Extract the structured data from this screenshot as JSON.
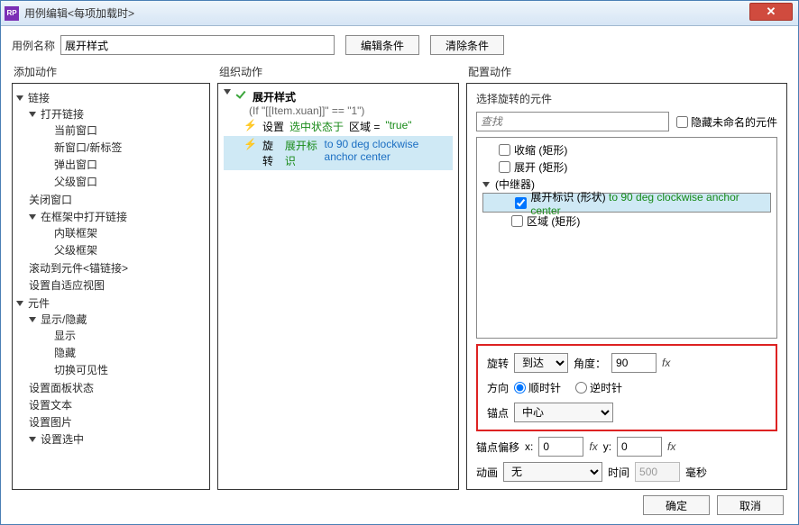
{
  "window": {
    "title": "用例编辑<每项加载时>"
  },
  "header": {
    "name_label": "用例名称",
    "name_value": "展开样式",
    "edit_condition": "编辑条件",
    "clear_condition": "清除条件"
  },
  "left": {
    "header": "添加动作",
    "tree": [
      {
        "label": "链接",
        "children": [
          {
            "label": "打开链接",
            "children": [
              "当前窗口",
              "新窗口/新标签",
              "弹出窗口",
              "父级窗口"
            ]
          },
          {
            "label": "关闭窗口"
          },
          {
            "label": "在框架中打开链接",
            "children": [
              "内联框架",
              "父级框架"
            ]
          },
          {
            "label": "滚动到元件<锚链接>"
          },
          {
            "label": "设置自适应视图"
          }
        ]
      },
      {
        "label": "元件",
        "children": [
          {
            "label": "显示/隐藏",
            "children": [
              "显示",
              "隐藏",
              "切换可见性"
            ]
          },
          {
            "label": "设置面板状态"
          },
          {
            "label": "设置文本"
          },
          {
            "label": "设置图片"
          },
          {
            "label": "设置选中"
          }
        ]
      }
    ]
  },
  "middle": {
    "header": "组织动作",
    "case": {
      "title": "展开样式",
      "condition": "(If \"[[Item.xuan]]\" == \"1\")"
    },
    "actions": [
      {
        "verb": "设置",
        "green_pre": "选中状态于",
        "mid": "区域 =",
        "green_post": "\"true\""
      },
      {
        "verb": "旋转",
        "target": "展开标识",
        "detail": "to 90 deg clockwise anchor center"
      }
    ]
  },
  "right": {
    "header": "配置动作",
    "select_label": "选择旋转的元件",
    "search_placeholder": "查找",
    "hide_unnamed": "隐藏未命名的元件",
    "elems": [
      "收缩 (矩形)",
      "展开 (矩形)",
      "(中继器)",
      {
        "name": "展开标识 (形状)",
        "detail": "to 90 deg clockwise anchor center"
      },
      "区域 (矩形)"
    ],
    "form": {
      "rotate_label": "旋转",
      "rotate_mode": "到达",
      "angle_label": "角度：",
      "angle_value": "90",
      "direction_label": "方向",
      "clockwise": "顺时针",
      "counter": "逆时针",
      "anchor_label": "锚点",
      "anchor_value": "中心",
      "offset_label": "锚点偏移",
      "offset_x": "0",
      "offset_y": "0",
      "anim_label": "动画",
      "anim_value": "无",
      "time_label": "时间",
      "time_value": "500",
      "ms": "毫秒"
    }
  },
  "footer": {
    "ok": "确定",
    "cancel": "取消"
  }
}
